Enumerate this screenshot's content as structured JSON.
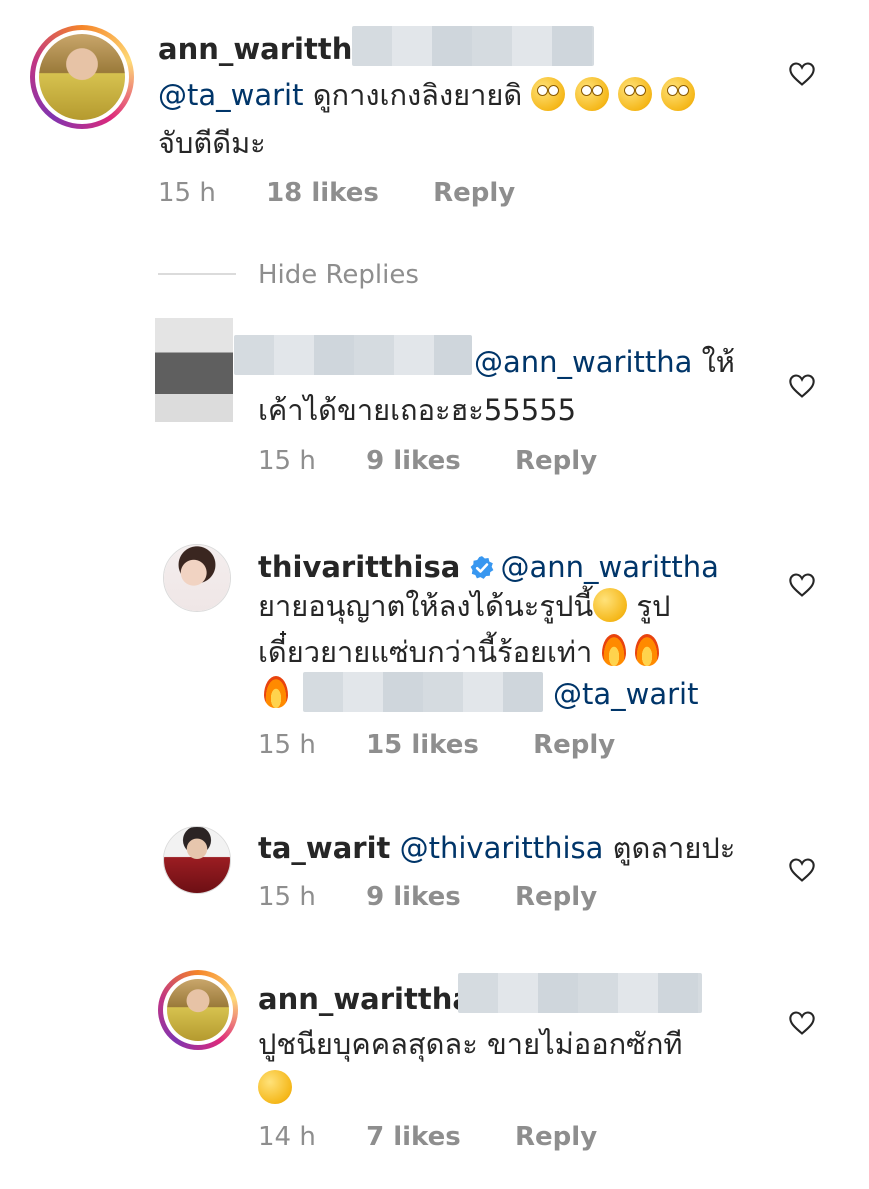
{
  "comments": [
    {
      "username": "ann_warittha",
      "line1_mention": "@ta_warit",
      "line1_text": " ดูกางเกงลิงยายดิ ",
      "line2_text": "จับตีดีมะ",
      "time": "15 h",
      "likes": "18 likes",
      "reply": "Reply"
    },
    {
      "line1_mention": "@ann_warittha",
      "line1_text": " ให้",
      "line2_text": "เค้าได้ขายเถอะฮะ55555",
      "time": "15 h",
      "likes": "9 likes",
      "reply": "Reply"
    },
    {
      "username": "thivaritthisa",
      "line1_mention": " @ann_warittha",
      "line2_text": "ยายอนุญาตให้ลงได้นะรูปนี้",
      "line2_tail": " รูป",
      "line3_text": "เดี๋ยวยายแซ่บกว่านี้ร้อยเท่า",
      "line4_mention": "@ta_warit",
      "time": "15 h",
      "likes": "15 likes",
      "reply": "Reply"
    },
    {
      "username": "ta_warit",
      "line1_mention": " @thivaritthisa",
      "line1_text": " ตูดลายปะ",
      "time": "15 h",
      "likes": "9 likes",
      "reply": "Reply"
    },
    {
      "username": "ann_warittha",
      "line2_text": "ปูชนียบุคคลสุดละ ขายไม่ออกซักที",
      "time": "14 h",
      "likes": "7 likes",
      "reply": "Reply"
    }
  ],
  "hide_replies": "Hide Replies",
  "colors": {
    "mention": "#003569",
    "meta": "#8e8e8e",
    "text": "#262626"
  },
  "icons": {
    "like": "heart-outline-icon",
    "verified": "verified-badge-icon"
  }
}
